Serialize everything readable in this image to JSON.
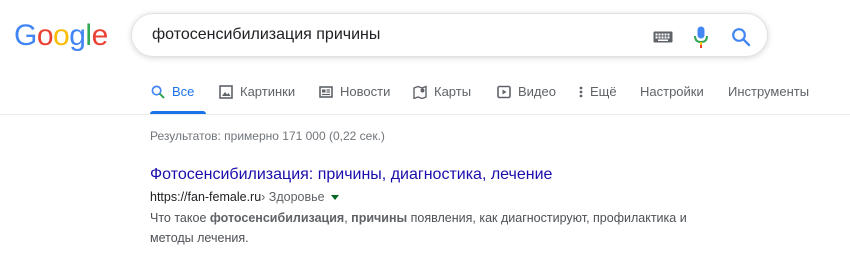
{
  "logo": {
    "letters": [
      "G",
      "o",
      "o",
      "g",
      "l",
      "e"
    ],
    "colors": [
      "#4285F4",
      "#EA4335",
      "#FBBC05",
      "#4285F4",
      "#34A853",
      "#EA4335"
    ]
  },
  "search": {
    "query": "фотосенсибилизация причины",
    "icons": [
      "keyboard-icon",
      "mic-icon",
      "search-icon"
    ]
  },
  "tabs": [
    {
      "label": "Все",
      "icon": "search-icon",
      "active": true
    },
    {
      "label": "Картинки",
      "icon": "image-icon",
      "active": false
    },
    {
      "label": "Новости",
      "icon": "news-icon",
      "active": false
    },
    {
      "label": "Карты",
      "icon": "map-icon",
      "active": false
    },
    {
      "label": "Видео",
      "icon": "video-icon",
      "active": false
    },
    {
      "label": "Ещё",
      "icon": "more-vert-icon",
      "active": false
    },
    {
      "label": "Настройки",
      "icon": "",
      "active": false
    },
    {
      "label": "Инструменты",
      "icon": "",
      "active": false
    }
  ],
  "stats": "Результатов: примерно 171 000 (0,22 сек.) ",
  "result": {
    "title": "Фотосенсибилизация: причины, диагностика, лечение",
    "url": "https://fan-female.ru",
    "breadcrumb": " › Здоровье",
    "snippet": [
      {
        "text": "Что такое ",
        "bold": false
      },
      {
        "text": "фотосенсибилизация",
        "bold": true
      },
      {
        "text": ", ",
        "bold": false
      },
      {
        "text": "причины",
        "bold": true
      },
      {
        "text": " появления, как диагностируют, профилактика и методы лечения.",
        "bold": false
      }
    ]
  },
  "colors": {
    "accent": "#1a73e8",
    "link": "#1a0dab",
    "text_secondary": "#5f6368"
  }
}
